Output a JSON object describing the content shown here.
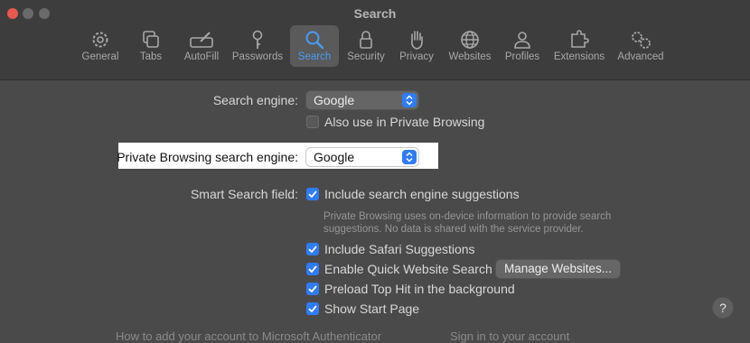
{
  "window": {
    "title": "Search"
  },
  "toolbar": {
    "items": [
      {
        "label": "General",
        "icon": "gear-icon",
        "selected": false
      },
      {
        "label": "Tabs",
        "icon": "tabs-icon",
        "selected": false
      },
      {
        "label": "AutoFill",
        "icon": "autofill-pencil-icon",
        "selected": false
      },
      {
        "label": "Passwords",
        "icon": "key-icon",
        "selected": false
      },
      {
        "label": "Search",
        "icon": "magnifier-icon",
        "selected": true
      },
      {
        "label": "Security",
        "icon": "lock-icon",
        "selected": false
      },
      {
        "label": "Privacy",
        "icon": "hand-icon",
        "selected": false
      },
      {
        "label": "Websites",
        "icon": "globe-icon",
        "selected": false
      },
      {
        "label": "Profiles",
        "icon": "person-icon",
        "selected": false
      },
      {
        "label": "Extensions",
        "icon": "puzzle-icon",
        "selected": false
      },
      {
        "label": "Advanced",
        "icon": "gears-icon",
        "selected": false
      }
    ]
  },
  "settings": {
    "search_engine_label": "Search engine:",
    "search_engine_value": "Google",
    "also_private_label": "Also use in Private Browsing",
    "also_private_checked": false,
    "private_engine_label": "Private Browsing search engine:",
    "private_engine_value": "Google",
    "smart_search_label": "Smart Search field:",
    "include_suggestions_label": "Include search engine suggestions",
    "include_suggestions_checked": true,
    "note_line1": "Private Browsing uses on-device information to provide search",
    "note_line2": "suggestions. No data is shared with the service provider.",
    "safari_suggestions_label": "Include Safari Suggestions",
    "safari_suggestions_checked": true,
    "quick_website_label": "Enable Quick Website Search",
    "quick_website_checked": true,
    "manage_websites_button": "Manage Websites...",
    "preload_label": "Preload Top Hit in the background",
    "preload_checked": true,
    "start_page_label": "Show Start Page",
    "start_page_checked": true,
    "help_button": "?"
  },
  "background_text": {
    "left": "How to add your account to Microsoft Authenticator",
    "right": "Sign in to your account"
  },
  "colors": {
    "accent": "#2f7cf6",
    "selected_label": "#4a9cf4",
    "window_bg": "#4a4a4a",
    "highlight": "#ffffff"
  }
}
